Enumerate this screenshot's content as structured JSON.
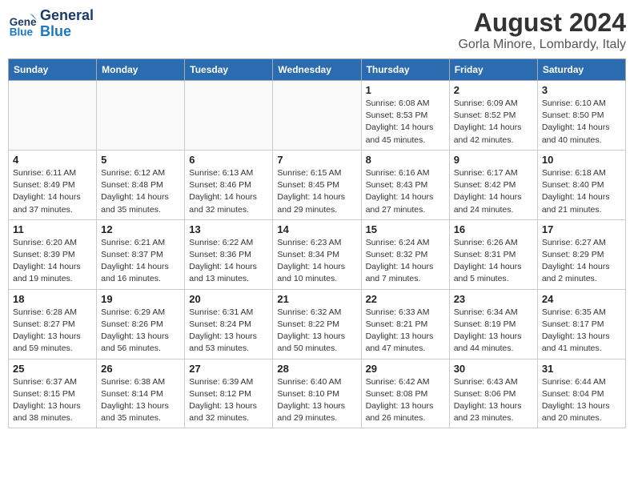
{
  "header": {
    "logo_line1": "General",
    "logo_line2": "Blue",
    "month_year": "August 2024",
    "location": "Gorla Minore, Lombardy, Italy"
  },
  "days_of_week": [
    "Sunday",
    "Monday",
    "Tuesday",
    "Wednesday",
    "Thursday",
    "Friday",
    "Saturday"
  ],
  "weeks": [
    [
      {
        "day": "",
        "info": ""
      },
      {
        "day": "",
        "info": ""
      },
      {
        "day": "",
        "info": ""
      },
      {
        "day": "",
        "info": ""
      },
      {
        "day": "1",
        "info": "Sunrise: 6:08 AM\nSunset: 8:53 PM\nDaylight: 14 hours and 45 minutes."
      },
      {
        "day": "2",
        "info": "Sunrise: 6:09 AM\nSunset: 8:52 PM\nDaylight: 14 hours and 42 minutes."
      },
      {
        "day": "3",
        "info": "Sunrise: 6:10 AM\nSunset: 8:50 PM\nDaylight: 14 hours and 40 minutes."
      }
    ],
    [
      {
        "day": "4",
        "info": "Sunrise: 6:11 AM\nSunset: 8:49 PM\nDaylight: 14 hours and 37 minutes."
      },
      {
        "day": "5",
        "info": "Sunrise: 6:12 AM\nSunset: 8:48 PM\nDaylight: 14 hours and 35 minutes."
      },
      {
        "day": "6",
        "info": "Sunrise: 6:13 AM\nSunset: 8:46 PM\nDaylight: 14 hours and 32 minutes."
      },
      {
        "day": "7",
        "info": "Sunrise: 6:15 AM\nSunset: 8:45 PM\nDaylight: 14 hours and 29 minutes."
      },
      {
        "day": "8",
        "info": "Sunrise: 6:16 AM\nSunset: 8:43 PM\nDaylight: 14 hours and 27 minutes."
      },
      {
        "day": "9",
        "info": "Sunrise: 6:17 AM\nSunset: 8:42 PM\nDaylight: 14 hours and 24 minutes."
      },
      {
        "day": "10",
        "info": "Sunrise: 6:18 AM\nSunset: 8:40 PM\nDaylight: 14 hours and 21 minutes."
      }
    ],
    [
      {
        "day": "11",
        "info": "Sunrise: 6:20 AM\nSunset: 8:39 PM\nDaylight: 14 hours and 19 minutes."
      },
      {
        "day": "12",
        "info": "Sunrise: 6:21 AM\nSunset: 8:37 PM\nDaylight: 14 hours and 16 minutes."
      },
      {
        "day": "13",
        "info": "Sunrise: 6:22 AM\nSunset: 8:36 PM\nDaylight: 14 hours and 13 minutes."
      },
      {
        "day": "14",
        "info": "Sunrise: 6:23 AM\nSunset: 8:34 PM\nDaylight: 14 hours and 10 minutes."
      },
      {
        "day": "15",
        "info": "Sunrise: 6:24 AM\nSunset: 8:32 PM\nDaylight: 14 hours and 7 minutes."
      },
      {
        "day": "16",
        "info": "Sunrise: 6:26 AM\nSunset: 8:31 PM\nDaylight: 14 hours and 5 minutes."
      },
      {
        "day": "17",
        "info": "Sunrise: 6:27 AM\nSunset: 8:29 PM\nDaylight: 14 hours and 2 minutes."
      }
    ],
    [
      {
        "day": "18",
        "info": "Sunrise: 6:28 AM\nSunset: 8:27 PM\nDaylight: 13 hours and 59 minutes."
      },
      {
        "day": "19",
        "info": "Sunrise: 6:29 AM\nSunset: 8:26 PM\nDaylight: 13 hours and 56 minutes."
      },
      {
        "day": "20",
        "info": "Sunrise: 6:31 AM\nSunset: 8:24 PM\nDaylight: 13 hours and 53 minutes."
      },
      {
        "day": "21",
        "info": "Sunrise: 6:32 AM\nSunset: 8:22 PM\nDaylight: 13 hours and 50 minutes."
      },
      {
        "day": "22",
        "info": "Sunrise: 6:33 AM\nSunset: 8:21 PM\nDaylight: 13 hours and 47 minutes."
      },
      {
        "day": "23",
        "info": "Sunrise: 6:34 AM\nSunset: 8:19 PM\nDaylight: 13 hours and 44 minutes."
      },
      {
        "day": "24",
        "info": "Sunrise: 6:35 AM\nSunset: 8:17 PM\nDaylight: 13 hours and 41 minutes."
      }
    ],
    [
      {
        "day": "25",
        "info": "Sunrise: 6:37 AM\nSunset: 8:15 PM\nDaylight: 13 hours and 38 minutes."
      },
      {
        "day": "26",
        "info": "Sunrise: 6:38 AM\nSunset: 8:14 PM\nDaylight: 13 hours and 35 minutes."
      },
      {
        "day": "27",
        "info": "Sunrise: 6:39 AM\nSunset: 8:12 PM\nDaylight: 13 hours and 32 minutes."
      },
      {
        "day": "28",
        "info": "Sunrise: 6:40 AM\nSunset: 8:10 PM\nDaylight: 13 hours and 29 minutes."
      },
      {
        "day": "29",
        "info": "Sunrise: 6:42 AM\nSunset: 8:08 PM\nDaylight: 13 hours and 26 minutes."
      },
      {
        "day": "30",
        "info": "Sunrise: 6:43 AM\nSunset: 8:06 PM\nDaylight: 13 hours and 23 minutes."
      },
      {
        "day": "31",
        "info": "Sunrise: 6:44 AM\nSunset: 8:04 PM\nDaylight: 13 hours and 20 minutes."
      }
    ]
  ]
}
